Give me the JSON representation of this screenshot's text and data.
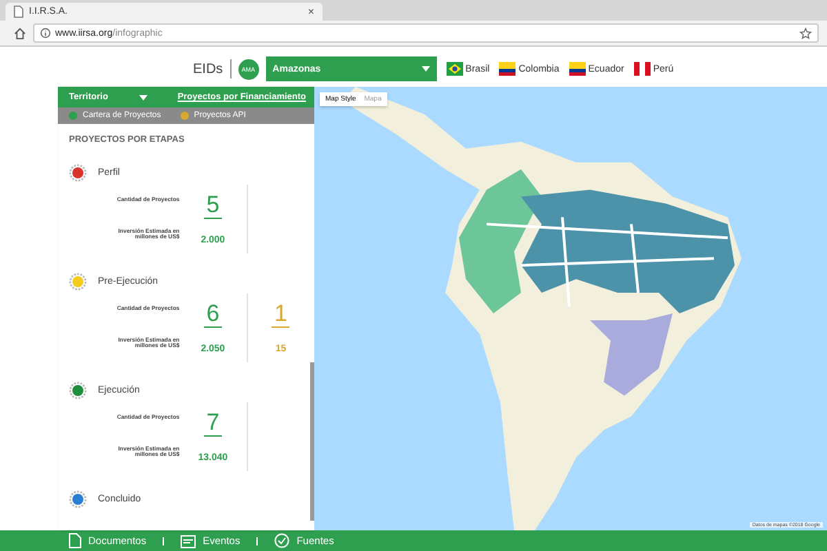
{
  "browser": {
    "tab_title": "I.I.R.S.A.",
    "tab_close": "×",
    "url_host": "www.iirsa.org",
    "url_path": "/infographic"
  },
  "header": {
    "eids_label": "EIDs",
    "badge": "AMA",
    "selector": "Amazonas",
    "countries": [
      {
        "name": "Brasil",
        "kind": "brazil"
      },
      {
        "name": "Colombia",
        "kind": "colombia"
      },
      {
        "name": "Ecuador",
        "kind": "ecuador"
      },
      {
        "name": "Perú",
        "kind": "peru"
      }
    ]
  },
  "panel": {
    "territory": "Territorio",
    "financing_link": "Proyectos por Financiamiento",
    "legend": [
      {
        "label": "Cartera de Proyectos",
        "color": "#2e9e4f"
      },
      {
        "label": "Proyectos API",
        "color": "#d9a82e"
      }
    ],
    "heading": "PROYECTOS POR ETAPAS",
    "stages": [
      {
        "name": "Perfil",
        "color": "#d9342b",
        "count_label": "Cantidad de Proyectos",
        "investment_label": "Inversión Estimada en millones de US$",
        "cartera": {
          "count": "5",
          "investment": "2.000"
        }
      },
      {
        "name": "Pre-Ejecución",
        "color": "#f2cc1f",
        "count_label": "Cantidad de Proyectos",
        "investment_label": "Inversión Estimada en millones de US$",
        "cartera": {
          "count": "6",
          "investment": "2.050"
        },
        "api": {
          "count": "1",
          "investment": "15"
        }
      },
      {
        "name": "Ejecución",
        "color": "#1f8f3e",
        "count_label": "Cantidad de Proyectos",
        "investment_label": "Inversión Estimada en millones de US$",
        "cartera": {
          "count": "7",
          "investment": "13.040"
        }
      },
      {
        "name": "Concluido",
        "color": "#2a7fd4"
      }
    ]
  },
  "map": {
    "styles": [
      {
        "label": "Map Style",
        "selected": true
      },
      {
        "label": "Mapa",
        "selected": false
      }
    ],
    "attribution": "Datos de mapas ©2018 Google"
  },
  "footer": [
    {
      "label": "Documentos",
      "kind": "document"
    },
    {
      "label": "Eventos",
      "kind": "calendar"
    },
    {
      "label": "Fuentes",
      "kind": "check"
    }
  ]
}
